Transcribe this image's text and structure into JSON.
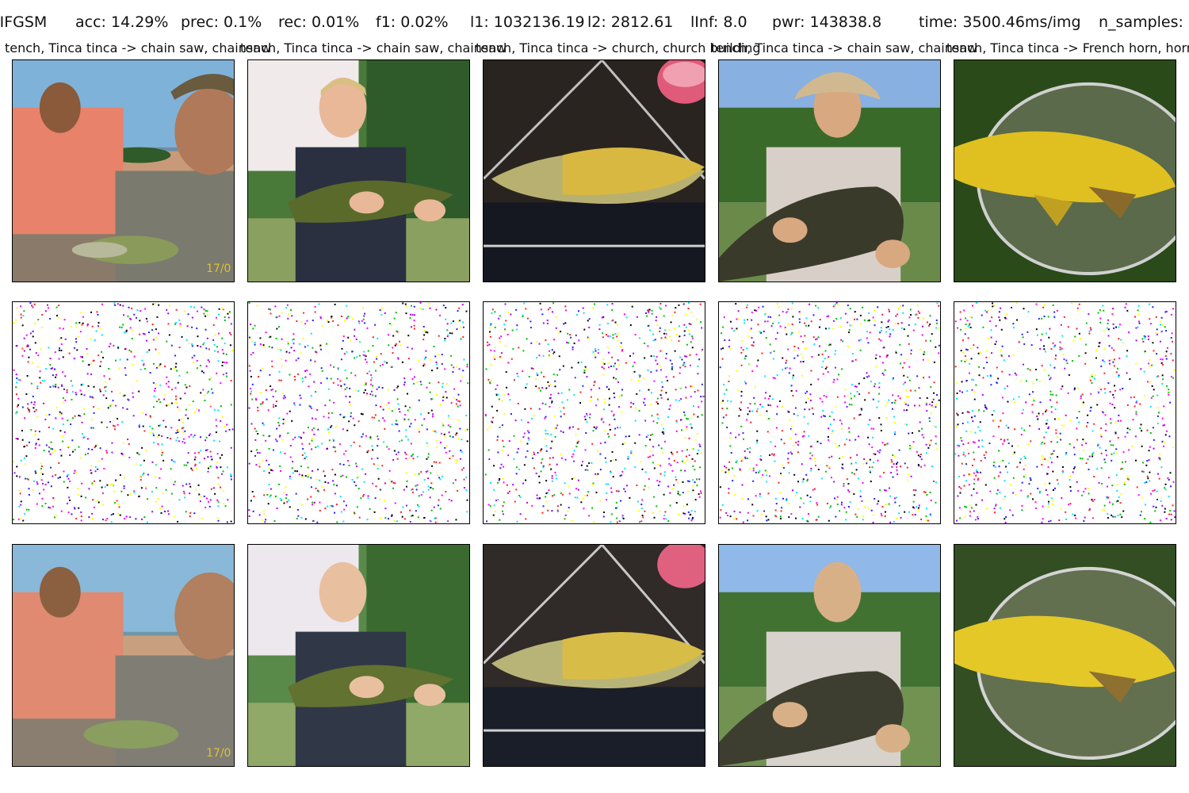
{
  "header": {
    "method": "IIFGSM",
    "acc": "acc: 14.29%",
    "prec": "prec: 0.1%",
    "rec": "rec: 0.01%",
    "f1": "f1: 0.02%",
    "l1": "l1: 1032136.19",
    "l2": "l2: 2812.61",
    "linf": "lInf: 8.0",
    "pwr": "pwr: 143838.8",
    "time": "time: 3500.46ms/img",
    "n_samples": "n_samples:"
  },
  "captions": [
    "tench, Tinca tinca -> chain saw, chainsaw",
    "tench, Tinca tinca -> chain saw, chainsaw",
    "tench, Tinca tinca -> church, church building",
    "tench, Tinca tinca -> chain saw, chainsaw",
    "tench, Tinca tinca -> French horn, horn"
  ],
  "images": {
    "original": [
      "two-men-holding-small-tench-photo",
      "boy-holding-tench-photo",
      "tench-in-landing-net-photo",
      "man-in-hat-holding-tench-photo",
      "yellow-tench-on-net-photo"
    ],
    "perturbation": [
      "perturbation-noise-map",
      "perturbation-noise-map",
      "perturbation-noise-map",
      "perturbation-noise-map",
      "perturbation-noise-map"
    ],
    "adversarial": [
      "adversarial-two-men-holding-tench-photo",
      "adversarial-boy-holding-tench-photo",
      "adversarial-tench-in-net-photo",
      "adversarial-man-holding-tench-photo",
      "adversarial-yellow-tench-photo"
    ]
  }
}
